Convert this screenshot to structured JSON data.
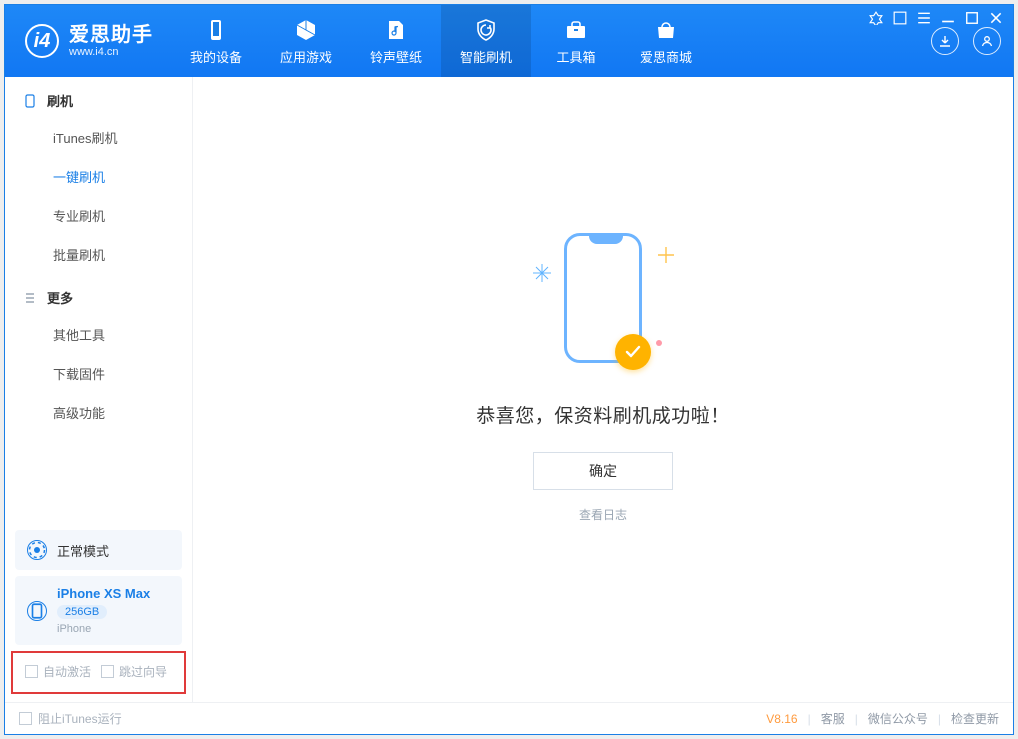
{
  "app": {
    "name": "爱思助手",
    "url": "www.i4.cn"
  },
  "tabs": [
    {
      "label": "我的设备"
    },
    {
      "label": "应用游戏"
    },
    {
      "label": "铃声壁纸"
    },
    {
      "label": "智能刷机"
    },
    {
      "label": "工具箱"
    },
    {
      "label": "爱思商城"
    }
  ],
  "sidebar": {
    "section1": {
      "title": "刷机",
      "items": [
        "iTunes刷机",
        "一键刷机",
        "专业刷机",
        "批量刷机"
      ],
      "activeIndex": 1
    },
    "section2": {
      "title": "更多",
      "items": [
        "其他工具",
        "下载固件",
        "高级功能"
      ]
    },
    "mode": "正常模式",
    "device": {
      "name": "iPhone XS Max",
      "capacity": "256GB",
      "type": "iPhone"
    },
    "options": {
      "autoActivate": "自动激活",
      "skipGuide": "跳过向导"
    }
  },
  "main": {
    "success": "恭喜您，保资料刷机成功啦！",
    "okBtn": "确定",
    "logLink": "查看日志"
  },
  "footer": {
    "blockItunes": "阻止iTunes运行",
    "version": "V8.16",
    "links": [
      "客服",
      "微信公众号",
      "检查更新"
    ]
  }
}
